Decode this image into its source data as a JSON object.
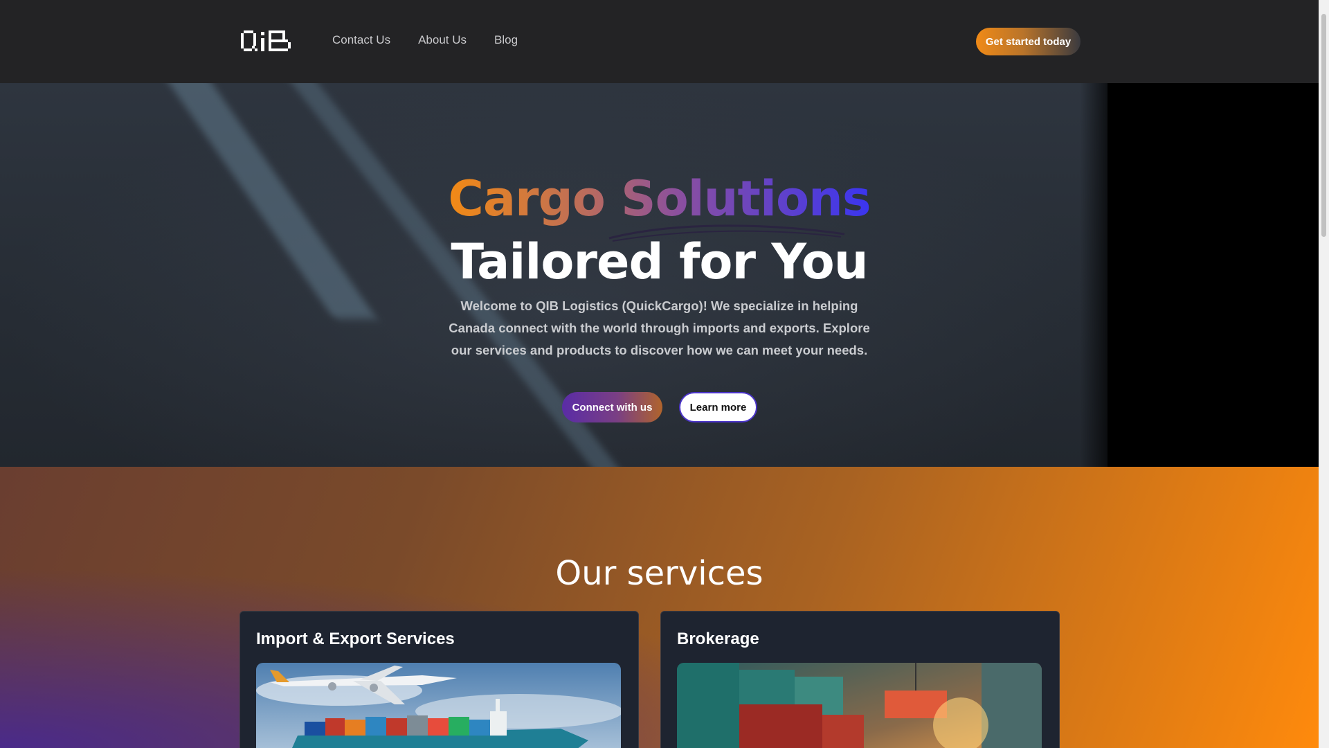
{
  "nav": {
    "logo_alt": "QIB",
    "links": [
      "Contact Us",
      "About Us",
      "Blog"
    ],
    "cta_label": "Get started today"
  },
  "hero": {
    "title_line1": "Cargo Solutions",
    "title_line2": "Tailored for You",
    "description": "Welcome to QIB Logistics (QuickCargo)! We specialize in helping Canada connect with the world through imports and exports. Explore our services and products to discover how we can meet your needs.",
    "primary_button": "Connect with us",
    "secondary_button": "Learn more"
  },
  "services": {
    "title": "Our services",
    "cards": [
      {
        "title": "Import & Export Services",
        "image": "airplane-cargo-ship-image"
      },
      {
        "title": "Brokerage",
        "image": "shipping-containers-image"
      }
    ]
  },
  "colors": {
    "accent_orange": "#f28a15",
    "accent_purple": "#5a2ca6",
    "accent_blue": "#3a35f0",
    "nav_bg": "#232325",
    "card_bg": "#1e2430"
  }
}
